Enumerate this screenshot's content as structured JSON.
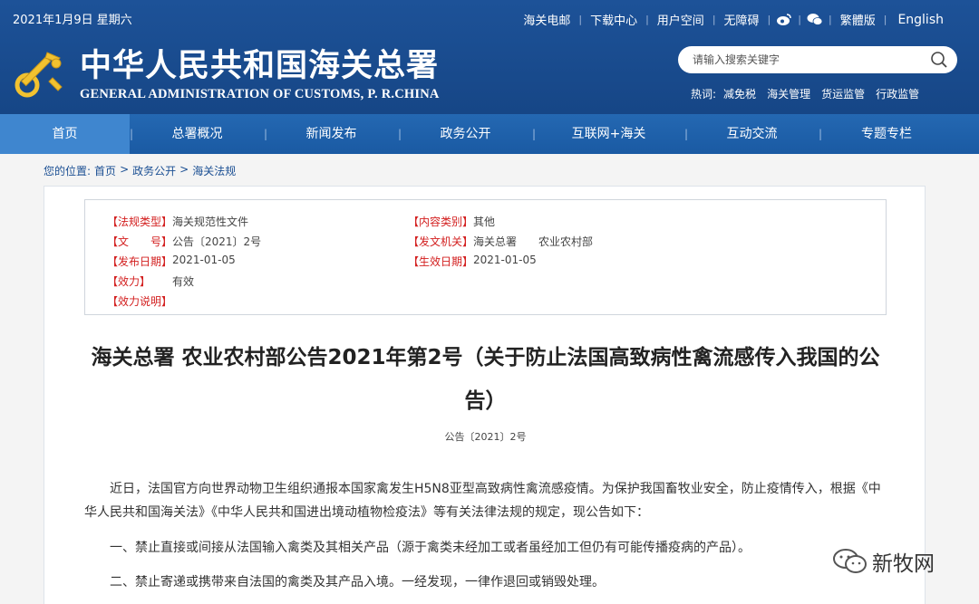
{
  "header": {
    "date": "2021年1月9日 星期六",
    "top_links": [
      "海关电邮",
      "下载中心",
      "用户空间",
      "无障碍"
    ],
    "traditional": "繁體版",
    "english": "English",
    "title_cn": "中华人民共和国海关总署",
    "title_en": "GENERAL ADMINISTRATION OF CUSTOMS, P. R.CHINA",
    "search_placeholder": "请输入搜索关键字",
    "hot_label": "热词:",
    "hot_words": [
      "减免税",
      "海关管理",
      "货运监管",
      "行政监管"
    ],
    "icons": [
      "weibo-icon",
      "wechat-icon",
      "search-icon"
    ]
  },
  "nav": {
    "items": [
      "首页",
      "总署概况",
      "新闻发布",
      "政务公开",
      "互联网+海关",
      "互动交流",
      "专题专栏"
    ],
    "active_index": 0
  },
  "breadcrumb": {
    "label": "您的位置:",
    "items": [
      "首页",
      "政务公开",
      "海关法规"
    ],
    "separator": ">"
  },
  "meta": {
    "rows": [
      {
        "k": "【法规类型】",
        "v": "海关规范性文件"
      },
      {
        "k": "【文　　号】",
        "v": "公告〔2021〕2号"
      },
      {
        "k": "【发布日期】",
        "v": "2021-01-05"
      },
      {
        "k": "【效力】",
        "v": "有效"
      },
      {
        "k": "【效力说明】",
        "v": ""
      }
    ],
    "rows_right": [
      {
        "k": "【内容类别】",
        "v": "其他"
      },
      {
        "k": "【发文机关】",
        "v": "海关总署　　农业农村部"
      },
      {
        "k": "【生效日期】",
        "v": "2021-01-05"
      }
    ]
  },
  "document": {
    "title": "海关总署 农业农村部公告2021年第2号（关于防止法国高致病性禽流感传入我国的公告）",
    "number": "公告〔2021〕2号",
    "paragraphs": [
      "近日，法国官方向世界动物卫生组织通报本国家禽发生H5N8亚型高致病性禽流感疫情。为保护我国畜牧业安全，防止疫情传入，根据《中华人民共和国海关法》《中华人民共和国进出境动植物检疫法》等有关法律法规的规定，现公告如下：",
      "一、禁止直接或间接从法国输入禽类及其相关产品（源于禽类未经加工或者虽经加工但仍有可能传播疫病的产品）。",
      "二、禁止寄递或携带来自法国的禽类及其产品入境。一经发现，一律作退回或销毁处理。"
    ]
  },
  "watermark": {
    "brand": "新牧网"
  },
  "colors": {
    "header_blue": "#1b4f93",
    "nav_blue": "#2060a8",
    "nav_active": "#3f86cf",
    "label_red": "#d32020"
  }
}
